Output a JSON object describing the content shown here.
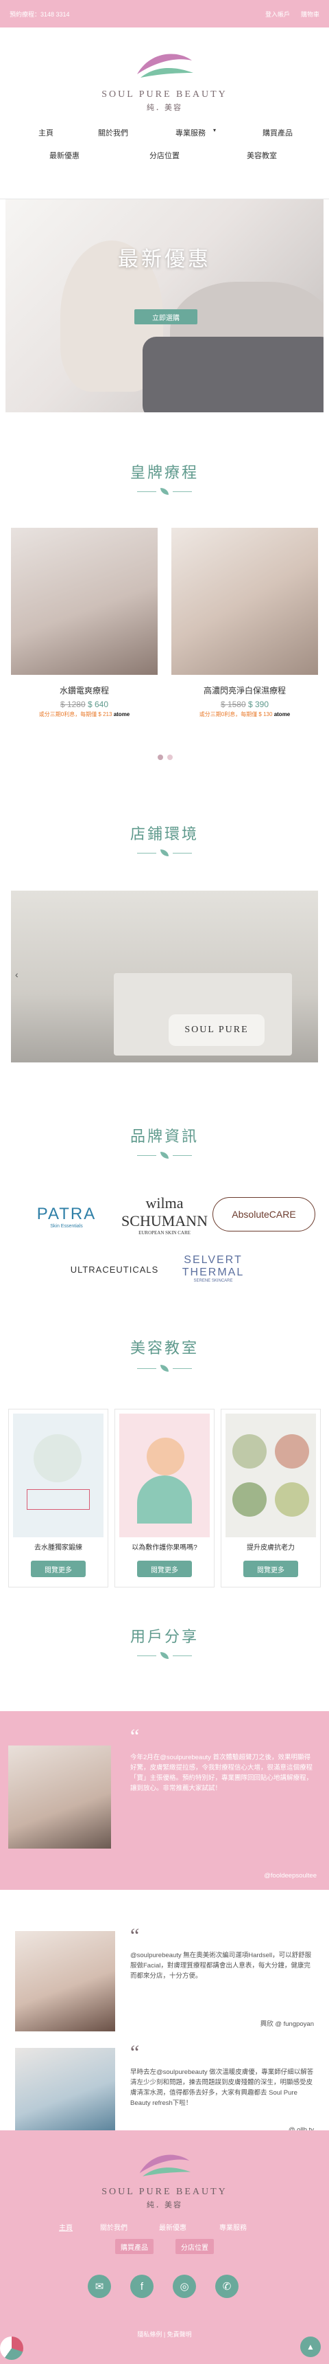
{
  "topbar": {
    "phone": "預約療程：3148 3314",
    "login": "登入帳戶",
    "cart": "購物車"
  },
  "logo": {
    "en": "SOUL PURE BEAUTY",
    "cn": "純．美容"
  },
  "nav": [
    "主頁",
    "關於我們",
    "專業服務",
    "購買產品",
    "最新優惠",
    "分店位置",
    "美容教室"
  ],
  "hero": {
    "title": "最新優惠",
    "button": "立即選購"
  },
  "sections": {
    "signature": "皇牌療程",
    "store": "店鋪環境",
    "brands": "品牌資訊",
    "class": "美容教室",
    "share": "用戶分享"
  },
  "treatments": [
    {
      "name": "水鑽電爽療程",
      "old": "$ 1280",
      "new": "$ 640",
      "note": "或分三期0利息，每期僅 $ 213"
    },
    {
      "name": "高濃閃亮淨白保濕療程",
      "old": "$ 1580",
      "new": "$ 390",
      "note": "或分三期0利息，每期僅 $ 130"
    }
  ],
  "atome": "atome",
  "brands": [
    "PATRA",
    "wilma SCHUMANN",
    "AbsoluteCARE",
    "ULTRACEUTICALS",
    "SELVERT THERMAL"
  ],
  "brand_subs": [
    "Skin Essentials",
    "EUROPEAN SKIN CARE",
    "",
    "",
    "SERENE SKINCARE"
  ],
  "blogs": [
    {
      "title": "去水腫獨家鍛練",
      "btn": "閱覽更多"
    },
    {
      "title": "以為敷作護你果嗎嗎?",
      "btn": "閱覽更多"
    },
    {
      "title": "提升皮膚抗老力",
      "btn": "閱覽更多"
    }
  ],
  "reviews": [
    {
      "text": "今年2月在@soulpurebeauty 首次體驗超聲刀之後，效果明顯得好驚，皮膚緊緻提拉感，令我對療程信心大增，很滿意這個療程「寶」主張優格。預約特別好，專業團隊回回貼心地講解療程，讓到放心。非常推薦大家試試！",
      "author": "@fooldeepsoultee"
    },
    {
      "text": "@soulpurebeauty 無在奧美術次編司運項Hardsell，可以舒舒服服做Facial，對膚理質療程都講會出人意表，每大分鐘，健康完而都來分店，十分方便。",
      "author": "興欣 @ fungpoyan"
    },
    {
      "text": "早時去左@soulpurebeauty 做次溫暖皮膚優，專業師仔細以解答清左少少刻和問題，揀去問題誤到皮膚殘體的深生，明顯感受皮膚清潔水潤，值得都係去好多，大家有興趣都去 Soul Pure Beauty refresh下啦！",
      "author": "@ ollb.ty"
    }
  ],
  "store_sign": "SOUL PURE",
  "footer": {
    "links": [
      "主頁",
      "關於我們",
      "最新優惠",
      "專業服務"
    ],
    "btns": [
      "購買產品",
      "分店位置"
    ],
    "copyright": "隱私條例 | 免責聲明"
  }
}
